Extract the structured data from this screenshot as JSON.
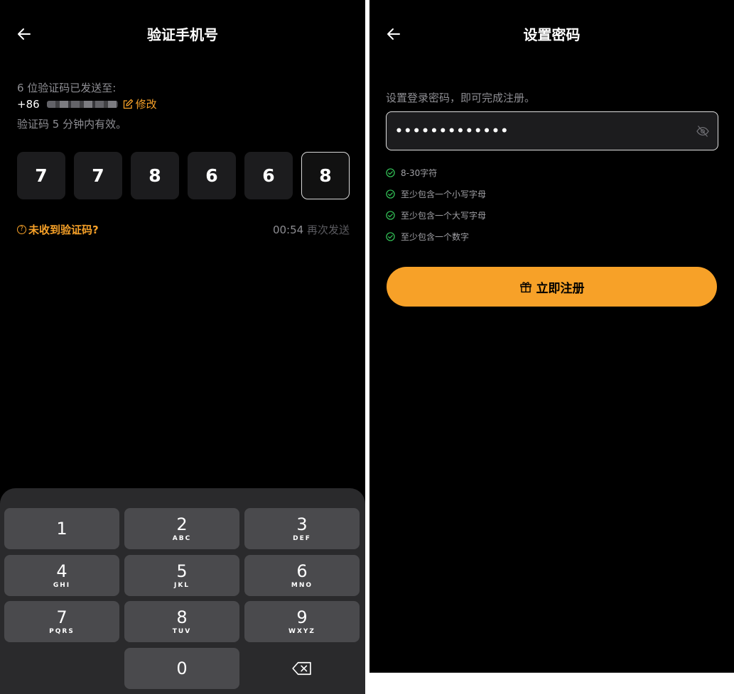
{
  "left": {
    "title": "验证手机号",
    "sent_text": "6 位验证码已发送至:",
    "phone_prefix": "+86",
    "edit_label": "修改",
    "valid_text": "验证码 5 分钟内有效。",
    "code_digits": [
      "7",
      "7",
      "8",
      "6",
      "6",
      "8"
    ],
    "help_label": "未收到验证码?",
    "countdown": "00:54",
    "resend_label": "再次发送",
    "keypad": [
      {
        "digit": "1",
        "letters": ""
      },
      {
        "digit": "2",
        "letters": "ABC"
      },
      {
        "digit": "3",
        "letters": "DEF"
      },
      {
        "digit": "4",
        "letters": "GHI"
      },
      {
        "digit": "5",
        "letters": "JKL"
      },
      {
        "digit": "6",
        "letters": "MNO"
      },
      {
        "digit": "7",
        "letters": "PQRS"
      },
      {
        "digit": "8",
        "letters": "TUV"
      },
      {
        "digit": "9",
        "letters": "WXYZ"
      },
      {
        "digit": "0",
        "letters": ""
      }
    ]
  },
  "right": {
    "title": "设置密码",
    "hint": "设置登录密码，即可完成注册。",
    "password_masked": "•••••••••••••",
    "rules": [
      "8-30字符",
      "至少包含一个小写字母",
      "至少包含一个大写字母",
      "至少包含一个数字"
    ],
    "register_label": "立即注册"
  },
  "colors": {
    "accent": "#f7a128",
    "background": "#000000",
    "key_bg": "#4a4a4d",
    "check_green": "#34c759"
  }
}
